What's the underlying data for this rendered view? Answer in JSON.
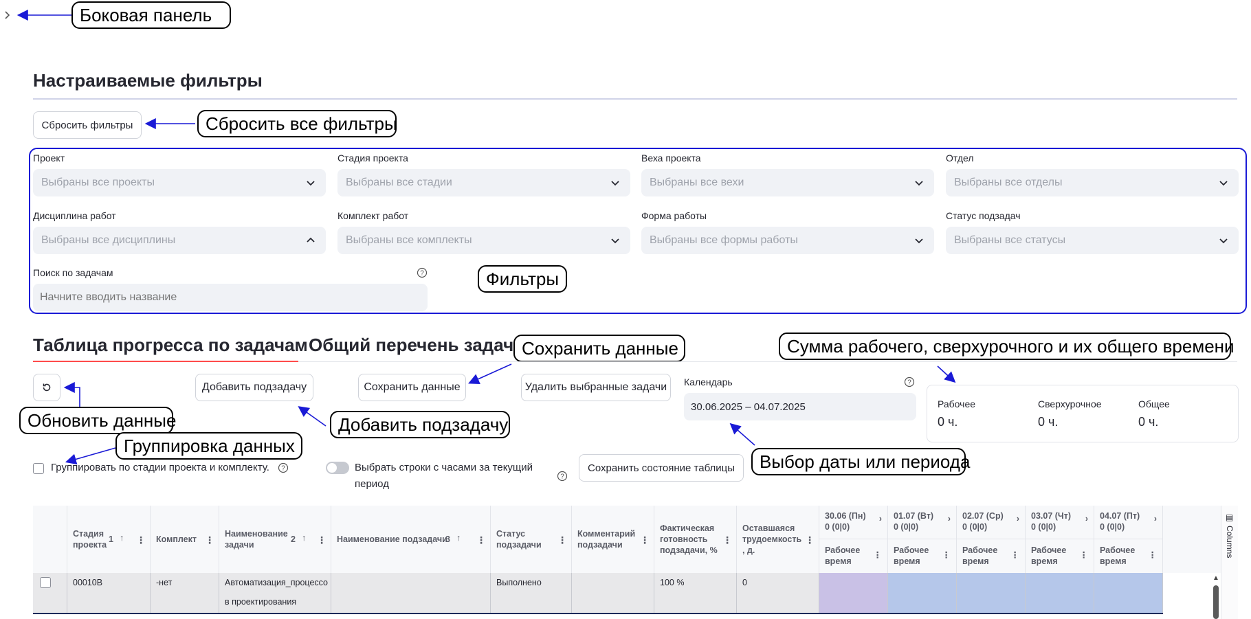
{
  "annotations": {
    "sidebar": "Боковая панель",
    "reset_all": "Сбросить все фильтры",
    "filters": "Фильтры",
    "save": "Сохранить данные",
    "sums": "Сумма рабочего, сверхурочного и их общего времени",
    "refresh": "Обновить данные",
    "add_subtask": "Добавить подзадачу",
    "grouping": "Группировка данных",
    "date_pick": "Выбор даты или периода"
  },
  "section_title": "Настраиваемые фильтры",
  "reset_button": "Сбросить фильтры",
  "filters": {
    "project": {
      "label": "Проект",
      "placeholder": "Выбраны все проекты"
    },
    "stage": {
      "label": "Стадия проекта",
      "placeholder": "Выбраны все стадии"
    },
    "milestone": {
      "label": "Веха проекта",
      "placeholder": "Выбраны все вехи"
    },
    "department": {
      "label": "Отдел",
      "placeholder": "Выбраны все отделы"
    },
    "discipline": {
      "label": "Дисциплина работ",
      "placeholder": "Выбраны все дисциплины"
    },
    "kit": {
      "label": "Комплект работ",
      "placeholder": "Выбраны все комплекты"
    },
    "work_form": {
      "label": "Форма работы",
      "placeholder": "Выбраны все формы работы"
    },
    "subtask_status": {
      "label": "Статус подзадач",
      "placeholder": "Выбраны все статусы"
    },
    "search": {
      "label": "Поиск по задачам",
      "placeholder": "Начните вводить название"
    }
  },
  "tabs": {
    "progress": "Таблица прогресса по задачам",
    "all_tasks": "Общий перечень задач"
  },
  "toolbar": {
    "add_subtask": "Добавить подзадачу",
    "save_data": "Сохранить данные",
    "delete_selected": "Удалить выбранные задачи",
    "save_table_state": "Сохранить состояние таблицы"
  },
  "calendar": {
    "label": "Календарь",
    "value": "30.06.2025 – 04.07.2025"
  },
  "metrics": {
    "work_label": "Рабочее",
    "work_value": "0 ч.",
    "overtime_label": "Сверхурочное",
    "overtime_value": "0 ч.",
    "total_label": "Общее",
    "total_value": "0 ч."
  },
  "options": {
    "group_checkbox": "Группировать по стадии проекта и комплекту.",
    "toggle_line1": "Выбрать строки с часами за текущий",
    "toggle_line2": "период"
  },
  "table": {
    "headers": {
      "stage": [
        "Стадия",
        "проекта"
      ],
      "stage_sort": "1",
      "kit": "Комплект",
      "task_name": [
        "Наименование",
        "задачи"
      ],
      "task_sort": "2",
      "subtask_name": "Наименование подзадачи",
      "subtask_sort": "3",
      "subtask_status": [
        "Статус",
        "подзадачи"
      ],
      "subtask_comment": [
        "Комментарий",
        "подзадачи"
      ],
      "readiness": [
        "Фактическая",
        "готовность",
        "подзадачи, %"
      ],
      "remaining": [
        "Оставшаяся",
        "трудоемкость",
        ", д."
      ]
    },
    "days": [
      {
        "date": "30.06 (Пн)",
        "sum": "0 (0|0)",
        "sub": [
          "Рабочее",
          "время"
        ]
      },
      {
        "date": "01.07 (Вт)",
        "sum": "0 (0|0)",
        "sub": [
          "Рабочее",
          "время"
        ]
      },
      {
        "date": "02.07 (Ср)",
        "sum": "0 (0|0)",
        "sub": [
          "Рабочее",
          "время"
        ]
      },
      {
        "date": "03.07 (Чт)",
        "sum": "0 (0|0)",
        "sub": [
          "Рабочее",
          "время"
        ]
      },
      {
        "date": "04.07 (Пт)",
        "sum": "0 (0|0)",
        "sub": [
          "Рабочее",
          "время"
        ]
      }
    ],
    "columns_label": "Columns",
    "row": {
      "stage": "00010В",
      "kit": "-нет",
      "task_line1": "Автоматизация_процессо",
      "task_line2": "в проектирования",
      "subtask": "",
      "status": "Выполнено",
      "comment": "",
      "readiness": "100 %",
      "remaining": "0"
    }
  }
}
